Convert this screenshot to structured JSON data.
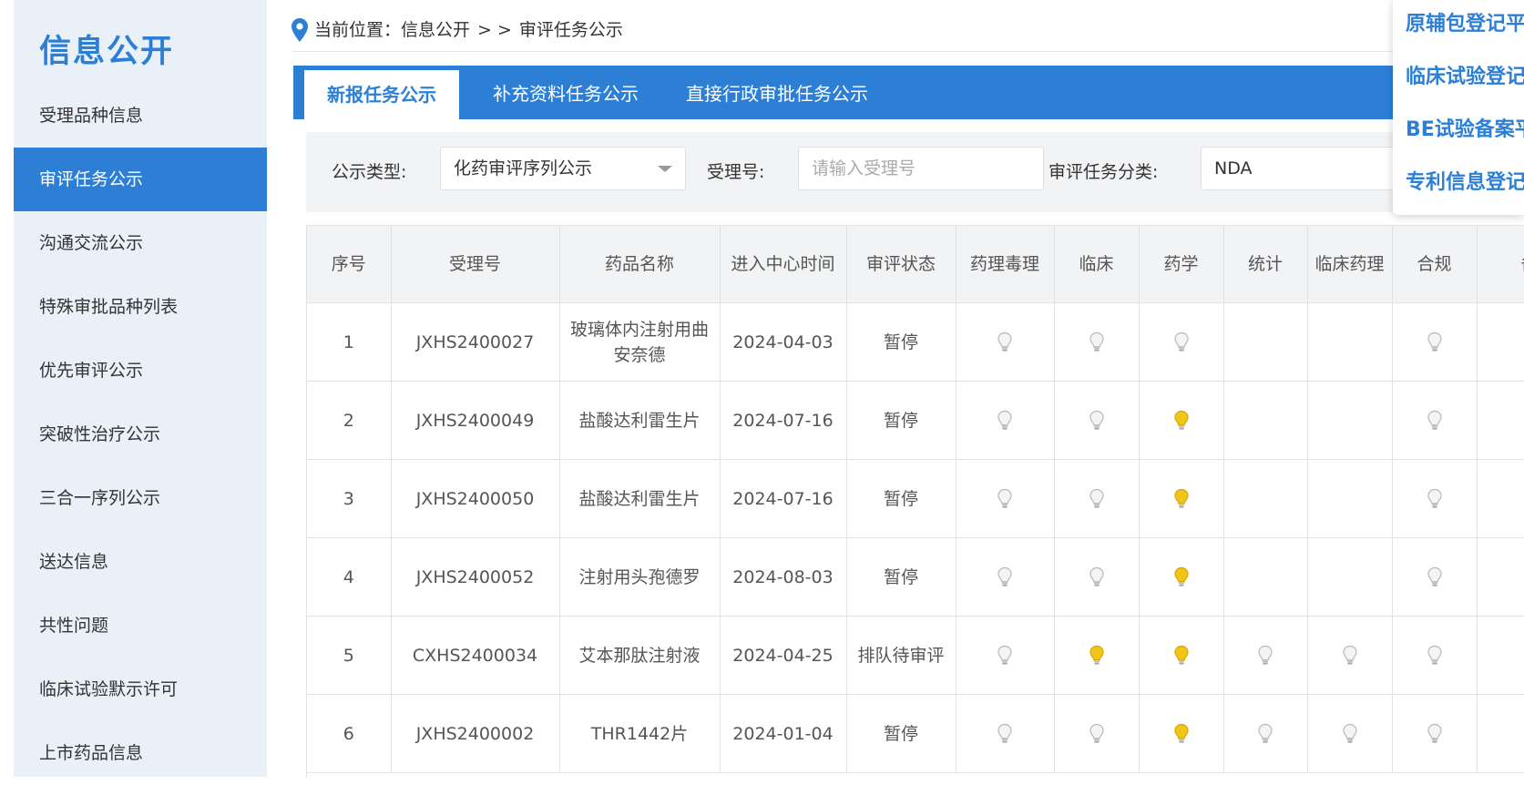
{
  "sidebar": {
    "title": "信息公开",
    "items": [
      {
        "label": "受理品种信息"
      },
      {
        "label": "审评任务公示"
      },
      {
        "label": "沟通交流公示"
      },
      {
        "label": "特殊审批品种列表"
      },
      {
        "label": "优先审评公示"
      },
      {
        "label": "突破性治疗公示"
      },
      {
        "label": "三合一序列公示"
      },
      {
        "label": "送达信息"
      },
      {
        "label": "共性问题"
      },
      {
        "label": "临床试验默示许可"
      },
      {
        "label": "上市药品信息"
      }
    ],
    "active_index": 1
  },
  "breadcrumb": {
    "prefix": "当前位置：",
    "section": "信息公开",
    "sep": "> >",
    "current": "审评任务公示"
  },
  "tabs": [
    {
      "label": "新报任务公示",
      "active": true
    },
    {
      "label": "补充资料任务公示",
      "active": false
    },
    {
      "label": "直接行政审批任务公示",
      "active": false
    }
  ],
  "filters": {
    "type_label": "公示类型:",
    "type_value": "化药审评序列公示",
    "accept_label": "受理号:",
    "accept_placeholder": "请输入受理号",
    "category_label": "审评任务分类:",
    "category_value": "NDA"
  },
  "table": {
    "headers": [
      "序号",
      "受理号",
      "药品名称",
      "进入中心时间",
      "审评状态",
      "药理毒理",
      "临床",
      "药学",
      "统计",
      "临床药理",
      "合规",
      "备"
    ],
    "rows": [
      {
        "no": "1",
        "id": "JXHS2400027",
        "name": "玻璃体内注射用曲安奈德",
        "date": "2024-04-03",
        "status": "暂停",
        "bulbs": [
          "off",
          "off",
          "off",
          "",
          "",
          "off"
        ]
      },
      {
        "no": "2",
        "id": "JXHS2400049",
        "name": "盐酸达利雷生片",
        "date": "2024-07-16",
        "status": "暂停",
        "bulbs": [
          "off",
          "off",
          "on",
          "",
          "",
          "off"
        ]
      },
      {
        "no": "3",
        "id": "JXHS2400050",
        "name": "盐酸达利雷生片",
        "date": "2024-07-16",
        "status": "暂停",
        "bulbs": [
          "off",
          "off",
          "on",
          "",
          "",
          "off"
        ]
      },
      {
        "no": "4",
        "id": "JXHS2400052",
        "name": "注射用头孢德罗",
        "date": "2024-08-03",
        "status": "暂停",
        "bulbs": [
          "off",
          "off",
          "on",
          "",
          "",
          "off"
        ]
      },
      {
        "no": "5",
        "id": "CXHS2400034",
        "name": "艾本那肽注射液",
        "date": "2024-04-25",
        "status": "排队待审评",
        "bulbs": [
          "off",
          "on",
          "on",
          "off",
          "off",
          "off"
        ]
      },
      {
        "no": "6",
        "id": "JXHS2400002",
        "name": "THR1442片",
        "date": "2024-01-04",
        "status": "暂停",
        "bulbs": [
          "off",
          "off",
          "on",
          "off",
          "off",
          "off"
        ]
      }
    ]
  },
  "float_panel": {
    "items": [
      "原辅包登记平",
      "临床试验登记",
      "BE试验备案平",
      "专利信息登记"
    ]
  },
  "colors": {
    "accent": "#2d7fd6",
    "bulb_on": "#f0c419",
    "bulb_off": "#d9d9d9"
  }
}
